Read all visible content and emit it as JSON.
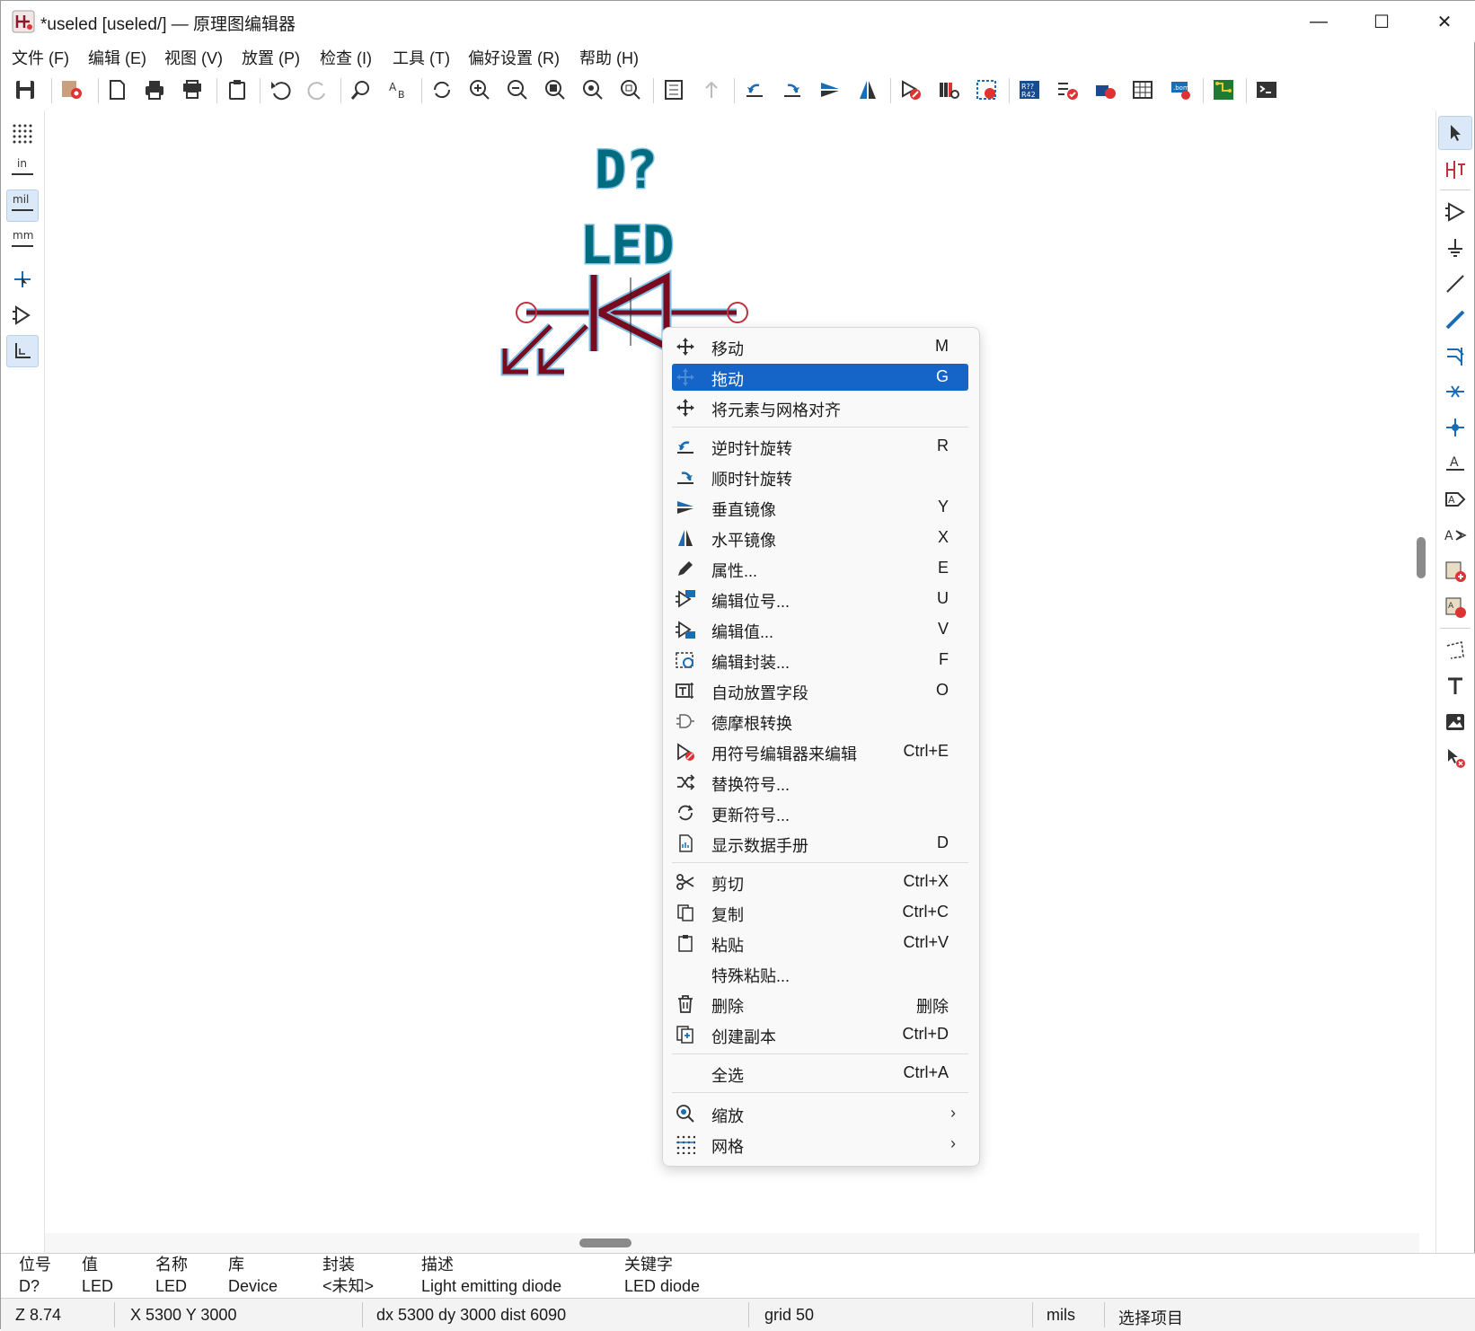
{
  "window": {
    "title": "*useled [useled/] — 原理图编辑器",
    "minimize_glyph": "—",
    "maximize_glyph": "☐",
    "close_glyph": "✕"
  },
  "menubar": [
    {
      "label": "文件 (F)"
    },
    {
      "label": "编辑 (E)"
    },
    {
      "label": "视图 (V)"
    },
    {
      "label": "放置 (P)"
    },
    {
      "label": "检查 (I)"
    },
    {
      "label": "工具 (T)"
    },
    {
      "label": "偏好设置 (R)"
    },
    {
      "label": "帮助 (H)"
    }
  ],
  "left_toolbar": {
    "unit_in": "in",
    "unit_mil": "mil",
    "unit_mm": "mm"
  },
  "symbol": {
    "reference": "D?",
    "value": "LED",
    "colors": {
      "body": "#7a0a1e",
      "field": "#006d7f",
      "pin": "#a3202e"
    }
  },
  "context_menu": {
    "items": [
      {
        "label": "移动",
        "key": "M",
        "icon": "move-icon"
      },
      {
        "label": "拖动",
        "key": "G",
        "icon": "drag-icon",
        "highlighted": true
      },
      {
        "label": "将元素与网格对齐",
        "key": "",
        "icon": "align-grid-icon"
      },
      {
        "label": "逆时针旋转",
        "key": "R",
        "icon": "rotate-ccw-icon"
      },
      {
        "label": "顺时针旋转",
        "key": "",
        "icon": "rotate-cw-icon"
      },
      {
        "label": "垂直镜像",
        "key": "Y",
        "icon": "mirror-vertical-icon"
      },
      {
        "label": "水平镜像",
        "key": "X",
        "icon": "mirror-horizontal-icon"
      },
      {
        "label": "属性...",
        "key": "E",
        "icon": "edit-pencil-icon"
      },
      {
        "label": "编辑位号...",
        "key": "U",
        "icon": "edit-reference-icon"
      },
      {
        "label": "编辑值...",
        "key": "V",
        "icon": "edit-value-icon"
      },
      {
        "label": "编辑封装...",
        "key": "F",
        "icon": "edit-footprint-icon"
      },
      {
        "label": "自动放置字段",
        "key": "O",
        "icon": "autoplace-fields-icon"
      },
      {
        "label": "德摩根转换",
        "key": "",
        "icon": "demorgan-icon"
      },
      {
        "label": "用符号编辑器来编辑",
        "key": "Ctrl+E",
        "icon": "symbol-editor-icon"
      },
      {
        "label": "替换符号...",
        "key": "",
        "icon": "shuffle-icon"
      },
      {
        "label": "更新符号...",
        "key": "",
        "icon": "refresh-icon"
      },
      {
        "label": "显示数据手册",
        "key": "D",
        "icon": "datasheet-icon"
      },
      {
        "label": "剪切",
        "key": "Ctrl+X",
        "icon": "scissors-icon"
      },
      {
        "label": "复制",
        "key": "Ctrl+C",
        "icon": "copy-icon"
      },
      {
        "label": "粘贴",
        "key": "Ctrl+V",
        "icon": "paste-icon"
      },
      {
        "label": "特殊粘贴...",
        "key": "",
        "icon": ""
      },
      {
        "label": "删除",
        "key": "删除",
        "icon": "trash-icon"
      },
      {
        "label": "创建副本",
        "key": "Ctrl+D",
        "icon": "duplicate-icon"
      },
      {
        "label": "全选",
        "key": "Ctrl+A",
        "icon": ""
      },
      {
        "label": "缩放",
        "key": "",
        "icon": "zoom-icon",
        "submenu": true
      },
      {
        "label": "网格",
        "key": "",
        "icon": "grid-icon",
        "submenu": true
      }
    ],
    "submenu_arrow": "›"
  },
  "info_panel": {
    "columns": [
      {
        "header": "位号",
        "value": "D?"
      },
      {
        "header": "值",
        "value": "LED"
      },
      {
        "header": "名称",
        "value": "LED"
      },
      {
        "header": "库",
        "value": "Device"
      },
      {
        "header": "封装",
        "value": "<未知>"
      },
      {
        "header": "描述",
        "value": "Light emitting diode"
      },
      {
        "header": "关键字",
        "value": "LED diode"
      }
    ]
  },
  "status_bar": {
    "zoom": "Z 8.74",
    "xy": "X 5300  Y 3000",
    "delta": "dx 5300  dy 3000  dist 6090",
    "grid": "grid 50",
    "units": "mils",
    "mode": "选择项目"
  },
  "colors": {
    "highlight": "#1565c8",
    "toolbar_active": "#dbe8f7"
  }
}
